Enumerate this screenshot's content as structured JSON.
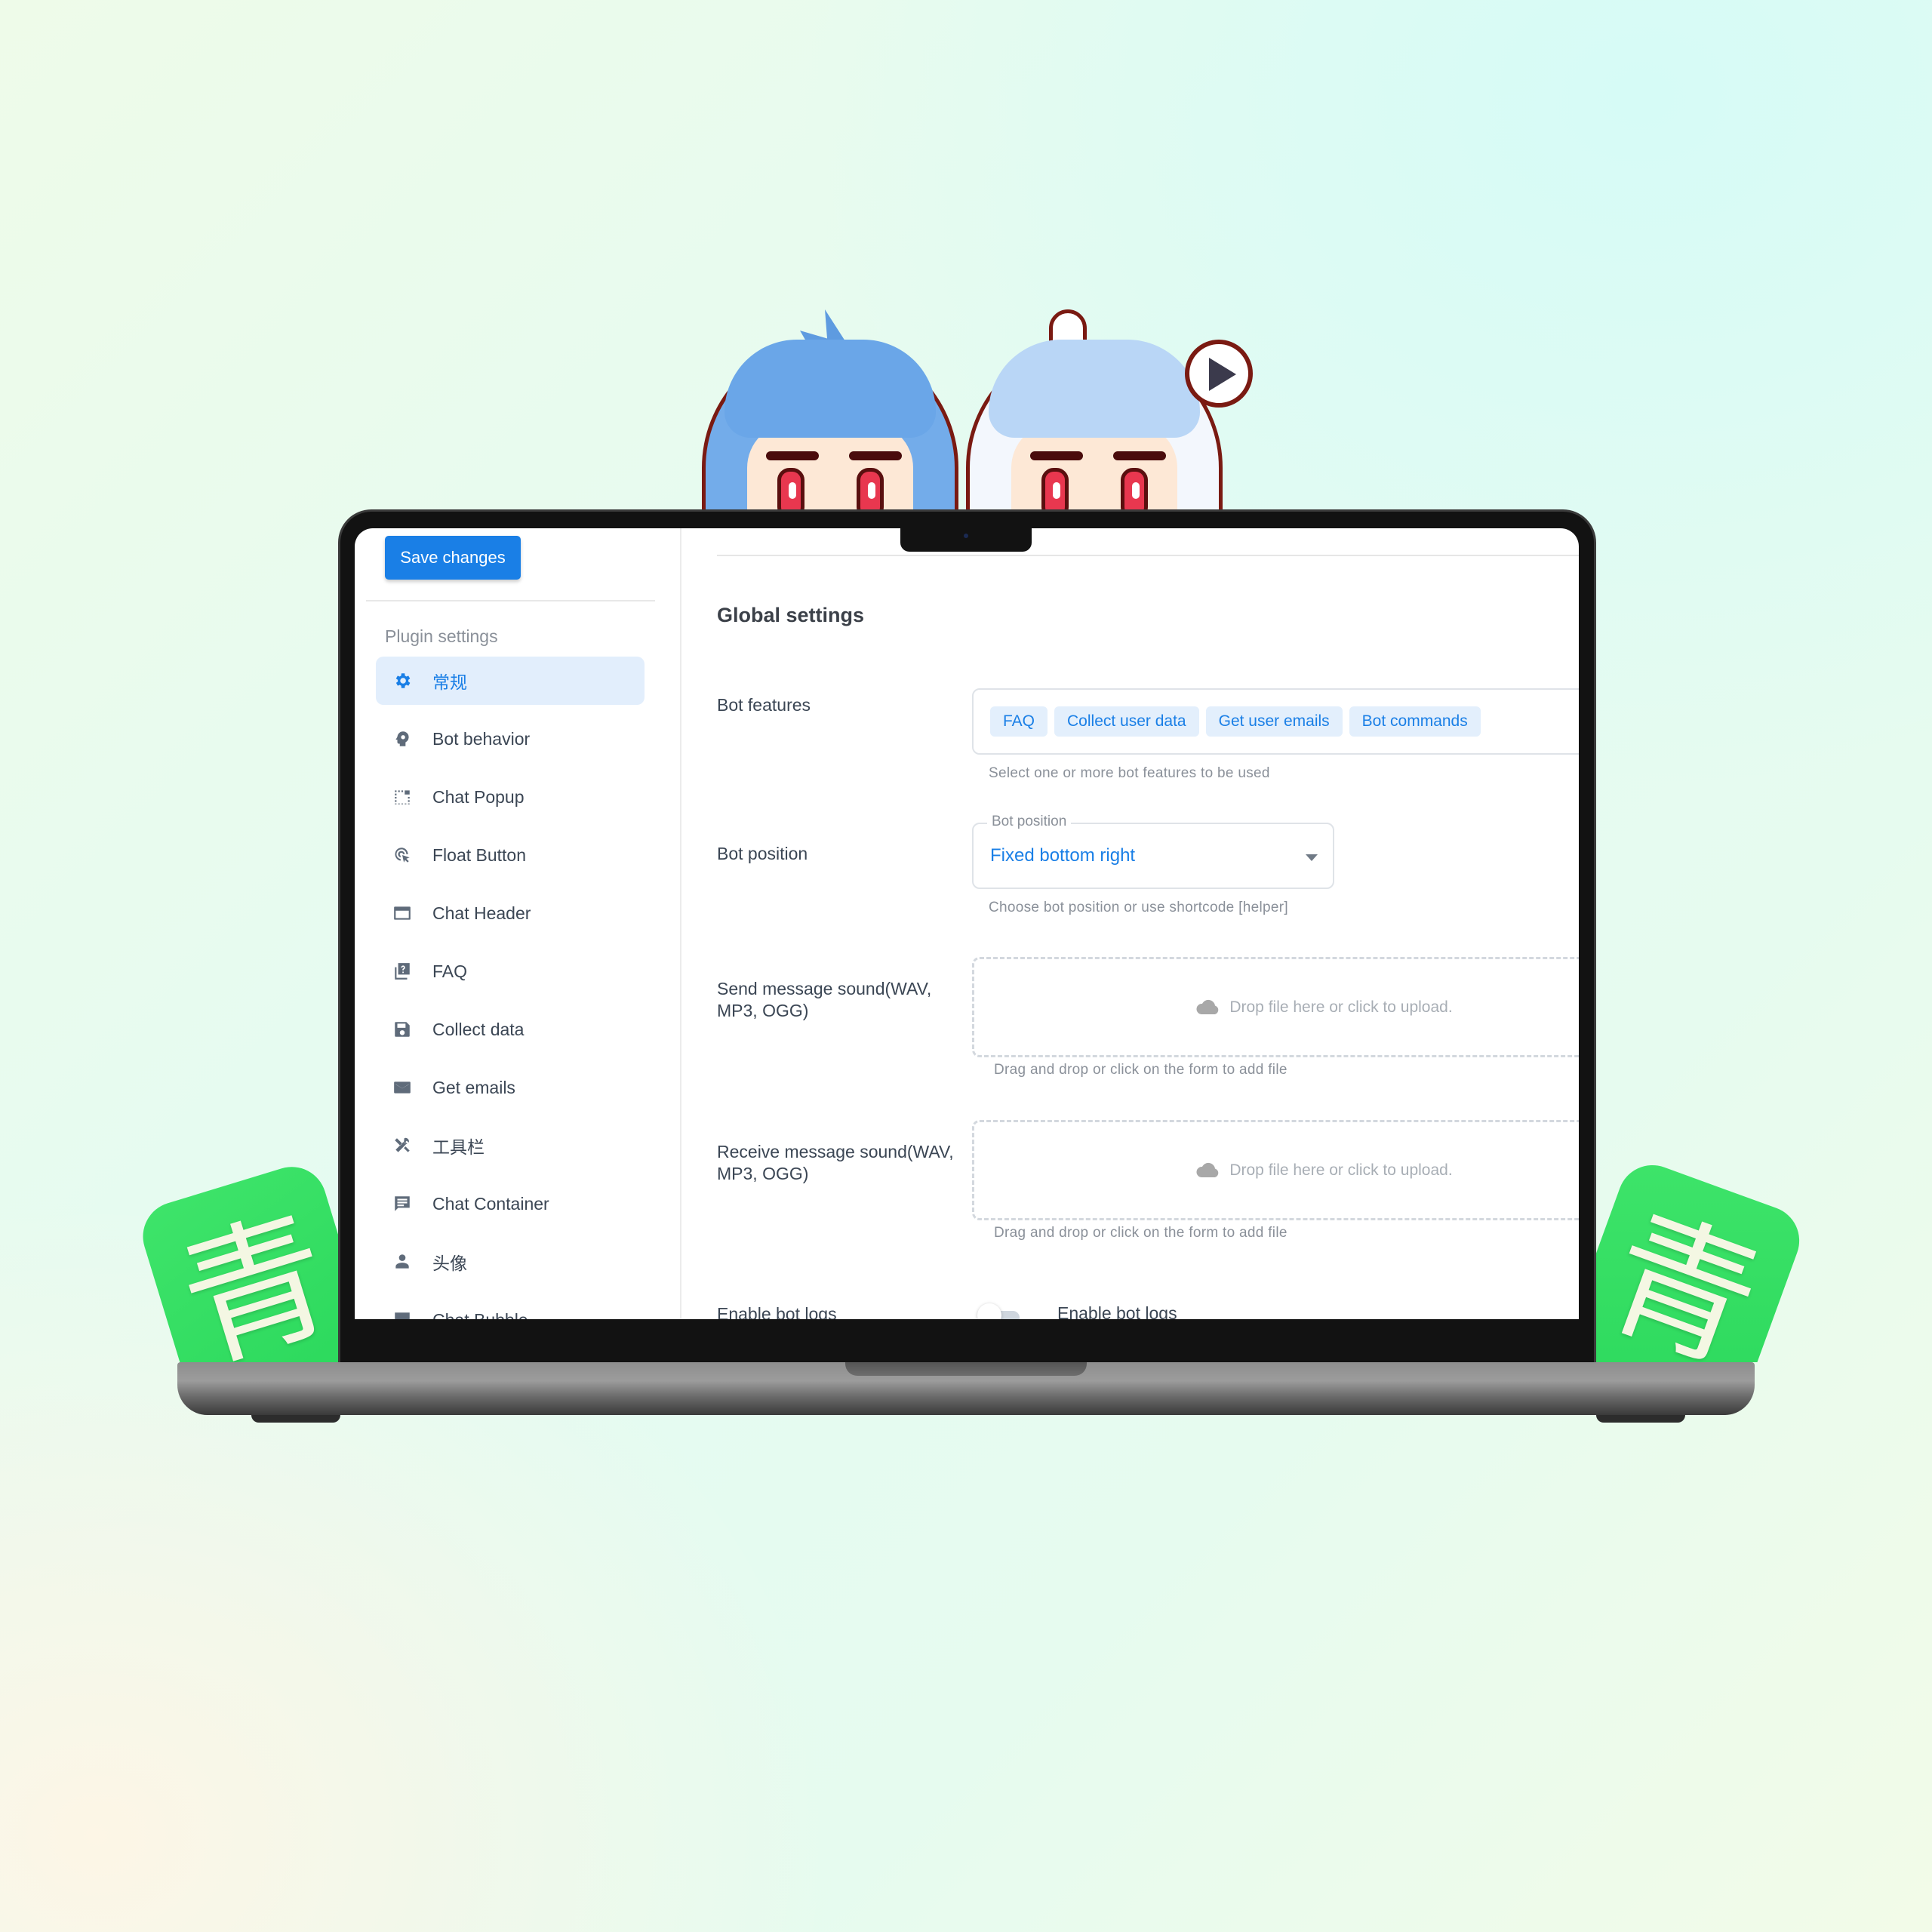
{
  "app": {
    "save_label": "Save changes",
    "sidebar": {
      "heading": "Plugin settings",
      "items": [
        {
          "label": "常规",
          "icon": "gear-icon",
          "active": true
        },
        {
          "label": "Bot behavior",
          "icon": "head-gear-icon"
        },
        {
          "label": "Chat Popup",
          "icon": "popup-icon"
        },
        {
          "label": "Float Button",
          "icon": "cursor-click-icon"
        },
        {
          "label": "Chat Header",
          "icon": "window-icon"
        },
        {
          "label": "FAQ",
          "icon": "faq-icon"
        },
        {
          "label": "Collect data",
          "icon": "floppy-icon"
        },
        {
          "label": "Get emails",
          "icon": "envelope-icon"
        },
        {
          "label": "工具栏",
          "icon": "tools-icon"
        },
        {
          "label": "Chat Container",
          "icon": "chat-list-icon"
        },
        {
          "label": "头像",
          "icon": "user-icon"
        },
        {
          "label": "Chat Bubble",
          "icon": "bubble-icon"
        }
      ]
    },
    "main": {
      "title": "Global settings",
      "bot_features": {
        "label": "Bot features",
        "chips": [
          "FAQ",
          "Collect user data",
          "Get user emails",
          "Bot commands"
        ],
        "helper": "Select one or more bot features to be used"
      },
      "bot_position": {
        "label": "Bot position",
        "legend": "Bot position",
        "value": "Fixed bottom right",
        "helper": "Choose bot position or use shortcode [helper]"
      },
      "send_sound": {
        "label": "Send message sound(WAV, MP3, OGG)",
        "drop_text": "Drop file here or click to upload.",
        "helper": "Drag and drop or click on the form to add file"
      },
      "receive_sound": {
        "label": "Receive message sound(WAV, MP3, OGG)",
        "drop_text": "Drop file here or click to upload.",
        "helper": "Drag and drop or click on the form to add file"
      },
      "bot_logs": {
        "label": "Enable bot logs",
        "toggle_label": "Enable bot logs",
        "enabled": false
      }
    }
  },
  "decor": {
    "tile_glyph": "青",
    "accent": "#1a7fe6",
    "tile_green": "#2bd85c"
  }
}
